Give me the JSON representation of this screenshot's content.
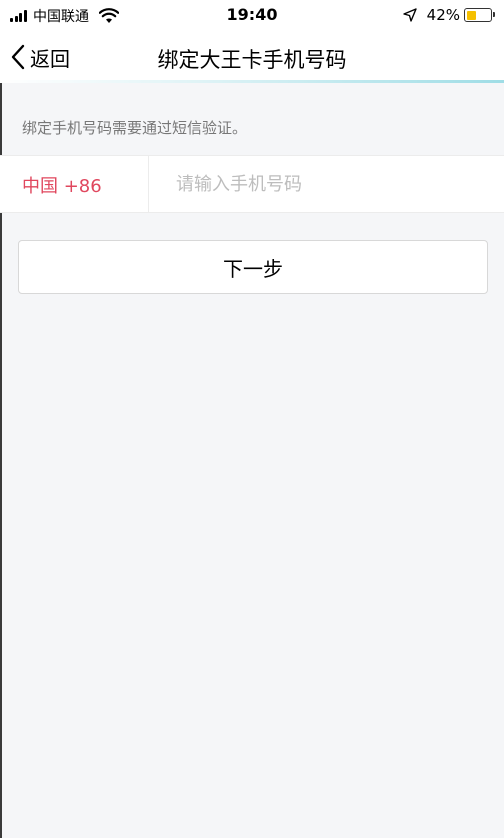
{
  "status_bar": {
    "carrier": "中国联通",
    "time": "19:40",
    "battery_percent": "42%",
    "battery_level": 0.42,
    "icons": [
      "signal-icon",
      "wifi-icon",
      "location-icon",
      "battery-icon"
    ]
  },
  "nav": {
    "back_label": "返回",
    "title": "绑定大王卡手机号码"
  },
  "form": {
    "hint": "绑定手机号码需要通过短信验证。",
    "country_code": "中国 +86",
    "phone_value": "",
    "phone_placeholder": "请输入手机号码",
    "next_label": "下一步"
  },
  "colors": {
    "accent_red": "#e0475e",
    "background": "#f5f6f8",
    "battery_fill": "#f5c000"
  }
}
